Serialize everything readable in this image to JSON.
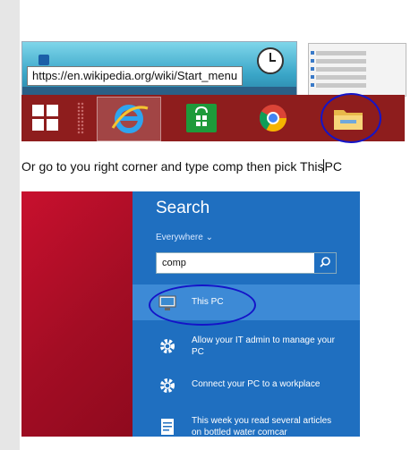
{
  "taskbar_shot": {
    "tooltip_url": "https://en.wikipedia.org/wiki/Start_menu",
    "taskbar_icons": [
      "windows-start-icon",
      "internet-explorer-icon",
      "store-icon",
      "chrome-icon",
      "file-explorer-icon"
    ],
    "taskbar_color": "#8e1d1d"
  },
  "instruction": {
    "before_caret": "Or go to you right corner and type comp then pick This",
    "after_caret": "PC"
  },
  "search_shot": {
    "title": "Search",
    "scope": "Everywhere",
    "query": "comp",
    "results": [
      {
        "label": "This PC",
        "icon": "computer-icon"
      },
      {
        "label": "Allow your IT admin to manage your PC",
        "icon": "settings-gear-icon"
      },
      {
        "label": "Connect your PC to a workplace",
        "icon": "settings-gear-icon"
      },
      {
        "label": "This week you read several articles on bottled water comcar",
        "icon": "document-icon"
      }
    ],
    "accent": "#1f6fc0",
    "side_color": "#c8102e",
    "annotation_color": "#1414c8"
  }
}
